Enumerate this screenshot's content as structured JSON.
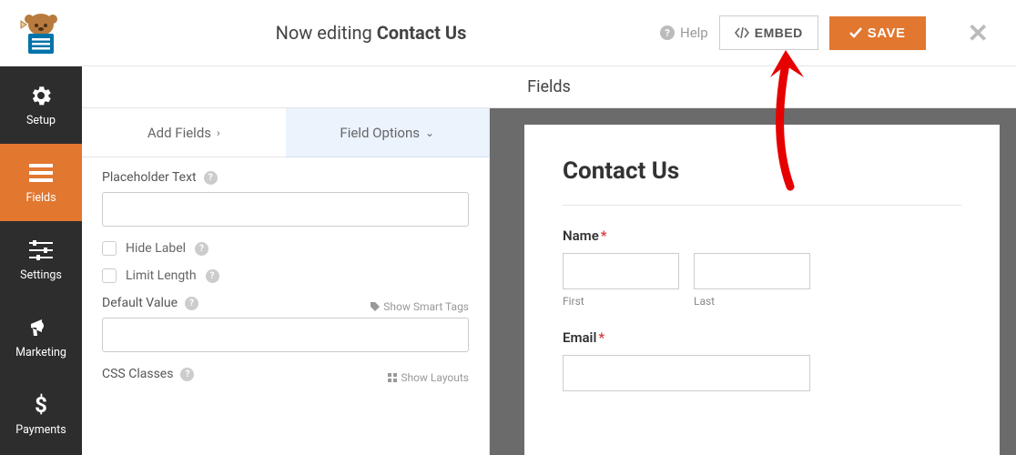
{
  "header": {
    "editing_prefix": "Now editing ",
    "form_name": "Contact Us",
    "help_label": "Help",
    "embed_label": "EMBED",
    "save_label": "SAVE"
  },
  "sidebar": {
    "items": [
      {
        "id": "setup",
        "label": "Setup"
      },
      {
        "id": "fields",
        "label": "Fields"
      },
      {
        "id": "settings",
        "label": "Settings"
      },
      {
        "id": "marketing",
        "label": "Marketing"
      },
      {
        "id": "payments",
        "label": "Payments"
      }
    ],
    "active": "fields"
  },
  "section_title": "Fields",
  "tabs": {
    "add_fields": "Add Fields",
    "field_options": "Field Options",
    "active": "field_options"
  },
  "options": {
    "placeholder_text_label": "Placeholder Text",
    "placeholder_text_value": "",
    "hide_label": "Hide Label",
    "limit_length": "Limit Length",
    "default_value_label": "Default Value",
    "default_value_value": "",
    "show_smart_tags": "Show Smart Tags",
    "css_classes_label": "CSS Classes",
    "show_layouts": "Show Layouts"
  },
  "preview": {
    "title": "Contact Us",
    "name_label": "Name",
    "first_label": "First",
    "last_label": "Last",
    "email_label": "Email"
  },
  "colors": {
    "accent": "#e27730",
    "sidebar_bg": "#2d2d2d",
    "required": "#d63638"
  }
}
